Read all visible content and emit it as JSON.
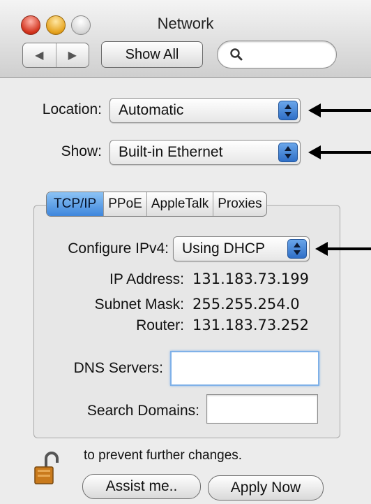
{
  "window": {
    "title": "Network"
  },
  "toolbar": {
    "show_all_label": "Show All",
    "search_placeholder": ""
  },
  "location": {
    "label": "Location:",
    "value": "Automatic"
  },
  "show": {
    "label": "Show:",
    "value": "Built-in Ethernet"
  },
  "tabs": [
    {
      "label": "TCP/IP",
      "active": true
    },
    {
      "label": "PPoE",
      "active": false
    },
    {
      "label": "AppleTalk",
      "active": false
    },
    {
      "label": "Proxies",
      "active": false
    }
  ],
  "tcpip": {
    "configure_label": "Configure IPv4:",
    "configure_value": "Using DHCP",
    "ip_address_label": "IP Address:",
    "ip_address_value": "131.183.73.199",
    "subnet_label": "Subnet Mask:",
    "subnet_value": "255.255.254.0",
    "router_label": "Router:",
    "router_value": "131.183.73.252",
    "dns_label": "DNS Servers:",
    "dns_value": "",
    "search_domains_label": "Search Domains:",
    "search_domains_value": ""
  },
  "footer": {
    "lock_text": "to prevent further changes.",
    "assist_label": "Assist me..",
    "apply_label": "Apply Now"
  },
  "icons": {
    "search": "magnifying-glass",
    "lock": "padlock-open",
    "back": "triangle-left",
    "forward": "triangle-right",
    "annotation": "arrow-left"
  },
  "colors": {
    "accent": "#3e86dc",
    "close": "#d2321c",
    "minimize": "#e5a21d"
  }
}
